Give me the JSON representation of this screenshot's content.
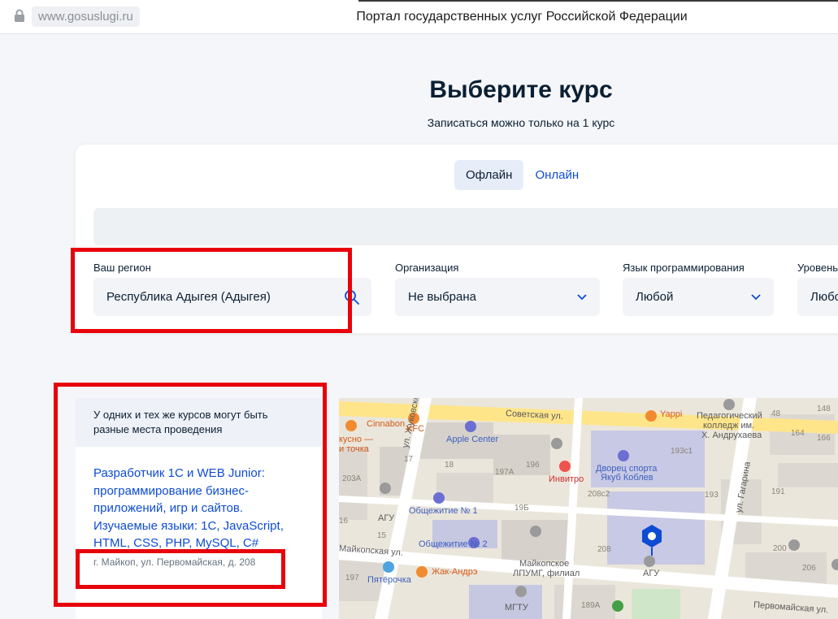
{
  "browser": {
    "url": "www.gosuslugi.ru",
    "page_title": "Портал государственных услуг Российской Федерации"
  },
  "header": {
    "title": "Выберите курс",
    "subtitle": "Записаться можно только на 1 курс"
  },
  "tabs": [
    {
      "label": "Офлайн",
      "active": true
    },
    {
      "label": "Онлайн",
      "active": false
    }
  ],
  "filters": {
    "region": {
      "label": "Ваш регион",
      "value": "Республика Адыгея (Адыгея)"
    },
    "organization": {
      "label": "Организация",
      "value": "Не выбрана"
    },
    "language": {
      "label": "Язык программирования",
      "value": "Любой"
    },
    "level": {
      "label": "Уровень",
      "value": "Любо"
    }
  },
  "info_panel": {
    "notice": "У одних и тех же курсов могут быть разные места проведения",
    "course_title": "Разработчик 1С и WEB Junior: программирование бизнес-приложений, игр и сайтов. Изучаемые языки: 1С, JavaScript, HTML, CSS, PHP, MySQL, C#",
    "address": "г. Майкоп, ул. Первомайская, д. 208"
  },
  "map": {
    "streets": {
      "sovetskaya": "Советская ул.",
      "zhukovskogo": "ул. Жуковского",
      "gagarina": "ул. Гагарина",
      "maikopskaya": "Майкопская ул.",
      "pervomaiskaya": "Первомайская ул."
    },
    "places": {
      "cinnabon": "Cinnabon",
      "kfc": "KFC",
      "vkusno": "кусно —",
      "tochka": "и точка",
      "apple": "Apple Center",
      "invitro": "Инвитро",
      "dvorets1": "Дворец спорта",
      "dvorets2": "Якуб Коблев",
      "yappi": "Yappi",
      "college1": "Педагогический",
      "college2": "колледж им.",
      "college3": "Х. Андрухаева",
      "obshch1": "Общежитие № 1",
      "obshch2": "Общежитие № 2",
      "agu1": "АГУ",
      "agu2": "АГУ",
      "pyaterochka": "Пятёрочка",
      "zhak": "Жак-Андрэ",
      "lpumg1": "Майкопское",
      "lpumg2": "ЛПУМГ, филиал",
      "mgtu": "МГТУ"
    },
    "numbers": [
      "193с1",
      "193",
      "208",
      "208с2",
      "197А",
      "196",
      "19Б",
      "18",
      "17",
      "203А",
      "15",
      "16",
      "197",
      "189А",
      "191",
      "200",
      "206",
      "164",
      "166",
      "148",
      "48"
    ]
  },
  "colors": {
    "accent_blue": "#0d4cd3",
    "highlight_red": "#e8000b",
    "tab_active_bg": "#e6edf8"
  }
}
